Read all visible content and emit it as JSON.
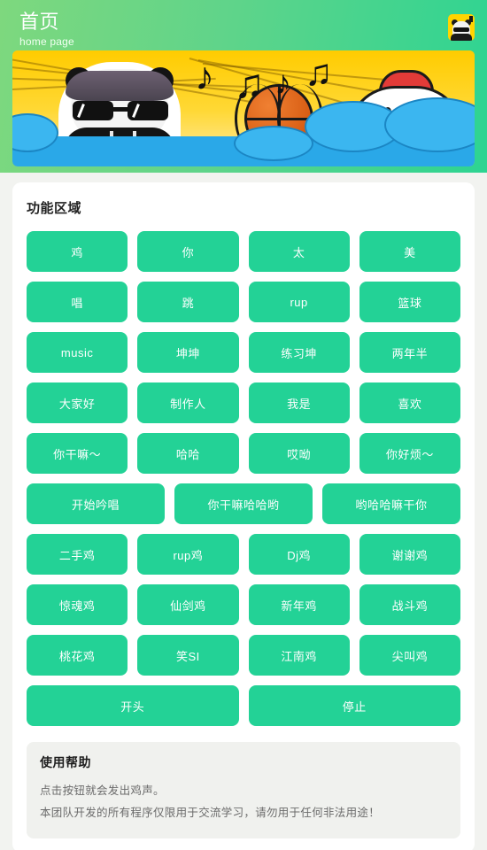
{
  "header": {
    "title": "首页",
    "subtitle": "home page",
    "avatar_icon": "panda-avatar-icon",
    "gradient_from": "#7ed87e",
    "gradient_to": "#2dd492"
  },
  "banner": {
    "name": "hero-banner",
    "alt": "panda meme with sunglasses, basketball, chicken and music notes on yellow background",
    "notes": [
      "♪",
      "♫",
      "♪",
      "♫"
    ],
    "colors": {
      "background": "#ffd21a",
      "water": "#2aa8e8",
      "basketball": "#d95f15",
      "comb": "#e23b38"
    }
  },
  "main": {
    "section_title": "功能区域",
    "accent_color": "#23d296",
    "button_rows": [
      [
        "鸡",
        "你",
        "太",
        "美"
      ],
      [
        "唱",
        "跳",
        "rup",
        "篮球"
      ],
      [
        "music",
        "坤坤",
        "练习坤",
        "两年半"
      ],
      [
        "大家好",
        "制作人",
        "我是",
        "喜欢"
      ],
      [
        "你干嘛～",
        "哈哈",
        "哎呦",
        "你好烦～"
      ],
      [
        "开始吟唱",
        "你干嘛哈哈哟",
        "哟哈哈嘛干你"
      ],
      [
        "二手鸡",
        "rup鸡",
        "Dj鸡",
        "谢谢鸡"
      ],
      [
        "惊魂鸡",
        "仙剑鸡",
        "新年鸡",
        "战斗鸡"
      ],
      [
        "桃花鸡",
        "笑SI",
        "江南鸡",
        "尖叫鸡"
      ],
      [
        "开头",
        "停止"
      ]
    ]
  },
  "help": {
    "title": "使用帮助",
    "lines": [
      "点击按钮就会发出鸡声。",
      "本团队开发的所有程序仅限用于交流学习，请勿用于任何非法用途！"
    ]
  }
}
